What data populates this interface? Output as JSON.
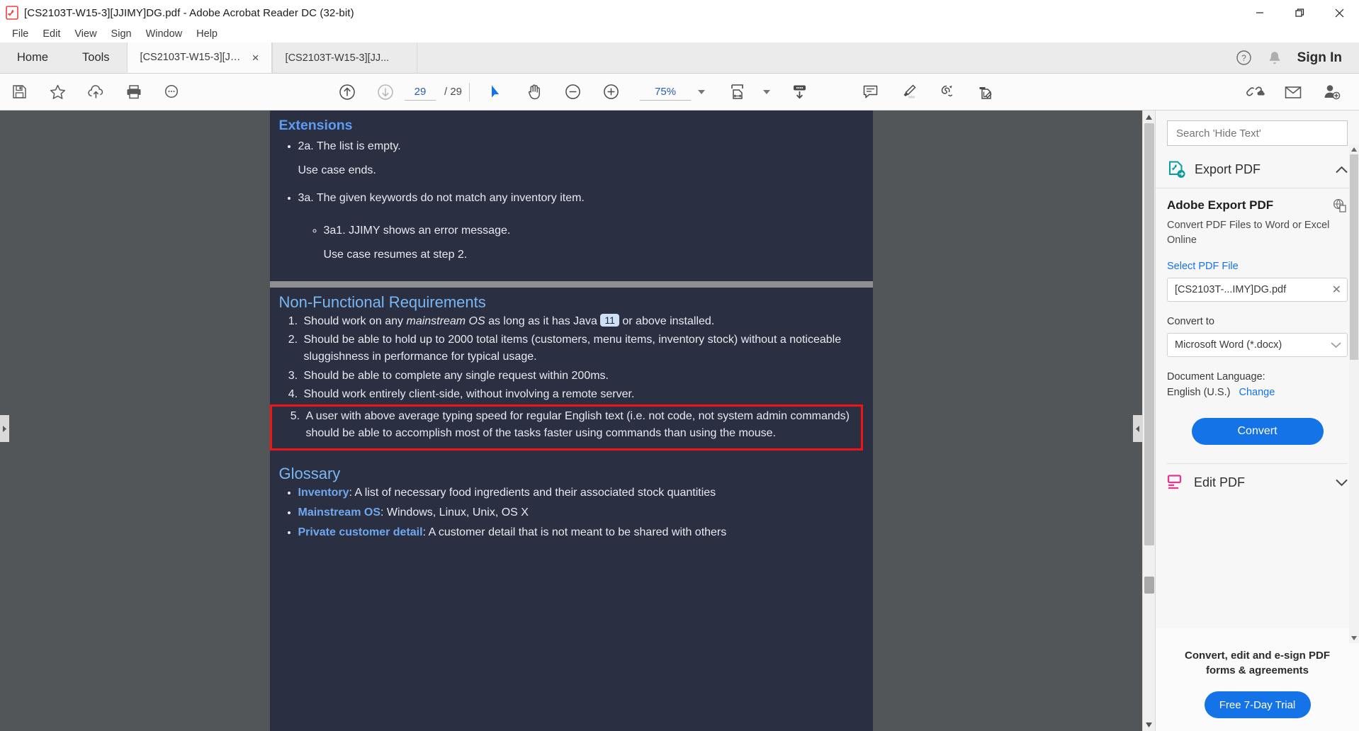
{
  "window": {
    "title": "[CS2103T-W15-3][JJIMY]DG.pdf - Adobe Acrobat Reader DC (32-bit)",
    "minimize_label": "Minimize",
    "restore_label": "Restore",
    "close_label": "Close"
  },
  "menubar": [
    "File",
    "Edit",
    "View",
    "Sign",
    "Window",
    "Help"
  ],
  "tabs": {
    "home": "Home",
    "tools": "Tools",
    "documents": [
      {
        "label": "[CS2103T-W15-3][JJ...",
        "active": true,
        "close": "×"
      },
      {
        "label": "[CS2103T-W15-3][JJ...",
        "active": false
      }
    ],
    "sign_in": "Sign In"
  },
  "toolbar": {
    "left_icons": [
      "save-icon",
      "star-icon",
      "upload-cloud-icon",
      "print-icon",
      "search-text-icon"
    ],
    "prev_page_icon": "arrow-up-circle-icon",
    "next_page_icon": "arrow-down-circle-icon",
    "page_current": "29",
    "page_total": "/ 29",
    "select_tool_icon": "cursor-select-icon",
    "hand_tool_icon": "hand-pan-icon",
    "zoom_out_icon": "zoom-out-icon",
    "zoom_in_icon": "zoom-in-icon",
    "zoom_value": "75%",
    "fit_width_icon": "fit-page-width-icon",
    "scroll_mode_icon": "page-scroll-down-icon",
    "comment_icon": "comment-icon",
    "highlight_icon": "highlighter-icon",
    "sign_icon": "sign-pen-icon",
    "fill_sign_icon": "fill-and-sign-icon",
    "right_icons": [
      "share-link-icon",
      "email-icon",
      "add-person-icon"
    ]
  },
  "document": {
    "extensions": {
      "heading": "Extensions",
      "items": [
        "2a. The list is empty.",
        "Use case ends.",
        "3a. The given keywords do not match any inventory item.",
        "3a1. JJIMY shows an error message.",
        "Use case resumes at step 2."
      ]
    },
    "nfr": {
      "heading": "Non-Functional Requirements",
      "items": [
        {
          "pre": "Should work on any ",
          "em": "mainstream OS",
          "mid": " as long as it has Java ",
          "badge": "11",
          "post": " or above installed."
        },
        {
          "text": "Should be able to hold up to 2000 total items (customers, menu items, inventory stock) without a noticeable sluggishness in performance for typical usage."
        },
        {
          "text": "Should be able to complete any single request within 200ms."
        },
        {
          "text": "Should work entirely client-side, without involving a remote server."
        },
        {
          "text": "A user with above average typing speed for regular English text (i.e. not code, not system admin commands) should be able to accomplish most of the tasks faster using commands than using the mouse.",
          "highlighted": true
        }
      ]
    },
    "glossary": {
      "heading": "Glossary",
      "items": [
        {
          "term": "Inventory",
          "definition": ": A list of necessary food ingredients and their associated stock quantities"
        },
        {
          "term": "Mainstream OS",
          "definition": ": Windows, Linux, Unix, OS X"
        },
        {
          "term": "Private customer detail",
          "definition": ": A customer detail that is not meant to be shared with others"
        }
      ]
    }
  },
  "sidebar": {
    "search_placeholder": "Search 'Hide Text'",
    "export_panel": {
      "title": "Export PDF",
      "collapse_icon": "chevron-up-icon",
      "heading": "Adobe Export PDF",
      "subtitle": "Convert PDF Files to Word or Excel Online",
      "select_file_link": "Select PDF File",
      "file_name": "[CS2103T-...IMY]DG.pdf",
      "file_remove": "✕",
      "convert_to_label": "Convert to",
      "convert_to_value": "Microsoft Word (*.docx)",
      "document_language_label": "Document Language:",
      "document_language_value": "English (U.S.)",
      "change_link": "Change",
      "convert_button": "Convert"
    },
    "edit_panel": {
      "title": "Edit PDF",
      "expand_icon": "chevron-down-icon"
    },
    "promo": {
      "text": "Convert, edit and e-sign PDF forms & agreements",
      "button": "Free 7-Day Trial"
    }
  },
  "colors": {
    "accent_blue": "#1473e6",
    "doc_bg": "#2b2f42",
    "doc_heading": "#79b7f2",
    "highlight_red": "#f01414",
    "viewer_bg": "#525659",
    "export_teal": "#0b9ba3",
    "edit_pink": "#e8368f"
  }
}
